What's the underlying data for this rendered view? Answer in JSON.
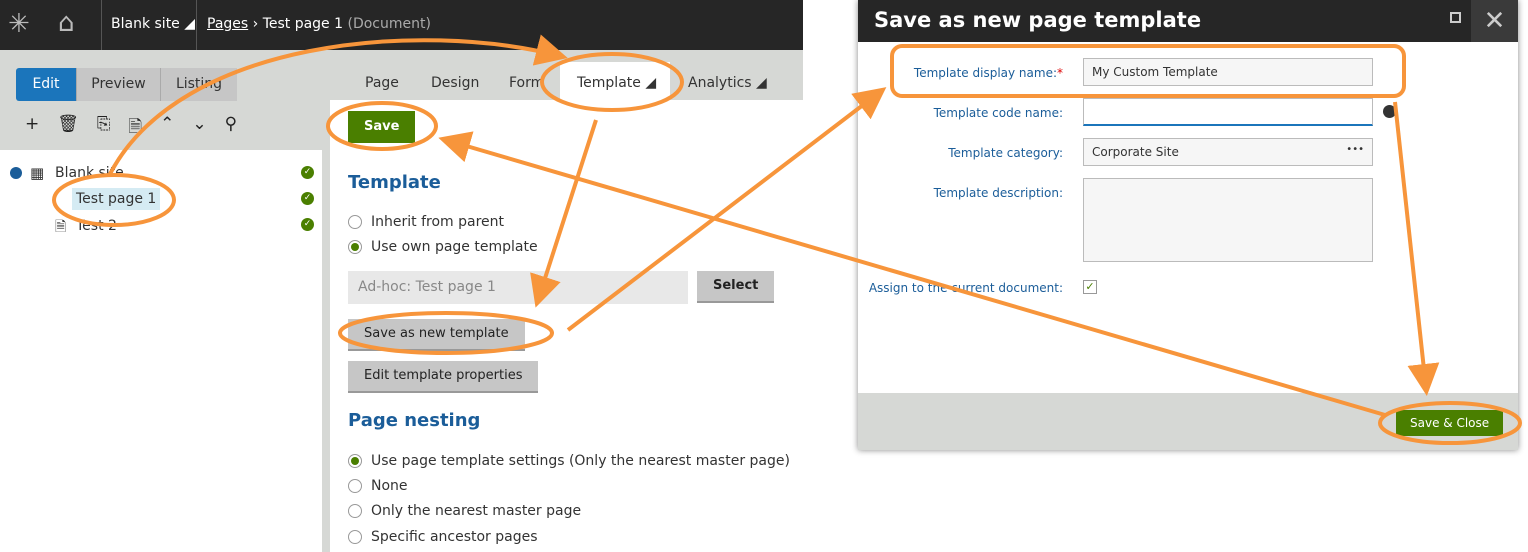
{
  "topbar": {
    "site": "Blank site",
    "breadcrumb_link": "Pages",
    "breadcrumb_current": "Test page 1",
    "breadcrumb_type": "(Document)"
  },
  "view_tabs": [
    "Edit",
    "Preview",
    "Listing"
  ],
  "tree": {
    "root": "Blank site",
    "items": [
      "Test page 1",
      "Test 2"
    ]
  },
  "page_tabs": [
    "Page",
    "Design",
    "Form",
    "Template",
    "Analytics"
  ],
  "content": {
    "save": "Save",
    "template_heading": "Template",
    "inherit": "Inherit from parent",
    "own": "Use own page template",
    "template_value": "Ad-hoc: Test page 1",
    "select": "Select",
    "save_new": "Save as new template",
    "edit_props": "Edit template properties",
    "nesting_heading": "Page nesting",
    "nesting_options": [
      "Use page template settings (Only the nearest master page)",
      "None",
      "Only the nearest master page",
      "Specific ancestor pages"
    ]
  },
  "dialog": {
    "title": "Save as new page template",
    "display_name_label": "Template display name:",
    "required": "*",
    "display_name_value": "My Custom Template",
    "code_name_label": "Template code name:",
    "code_name_value": "",
    "category_label": "Template category:",
    "category_value": "Corporate Site",
    "category_more": "•••",
    "description_label": "Template description:",
    "assign_label": "Assign to the current document:",
    "assign_checked": true,
    "save_close": "Save & Close"
  },
  "colors": {
    "accent": "#1b75bb",
    "save_green": "#4a7f00",
    "annotation": "#f7953b"
  }
}
